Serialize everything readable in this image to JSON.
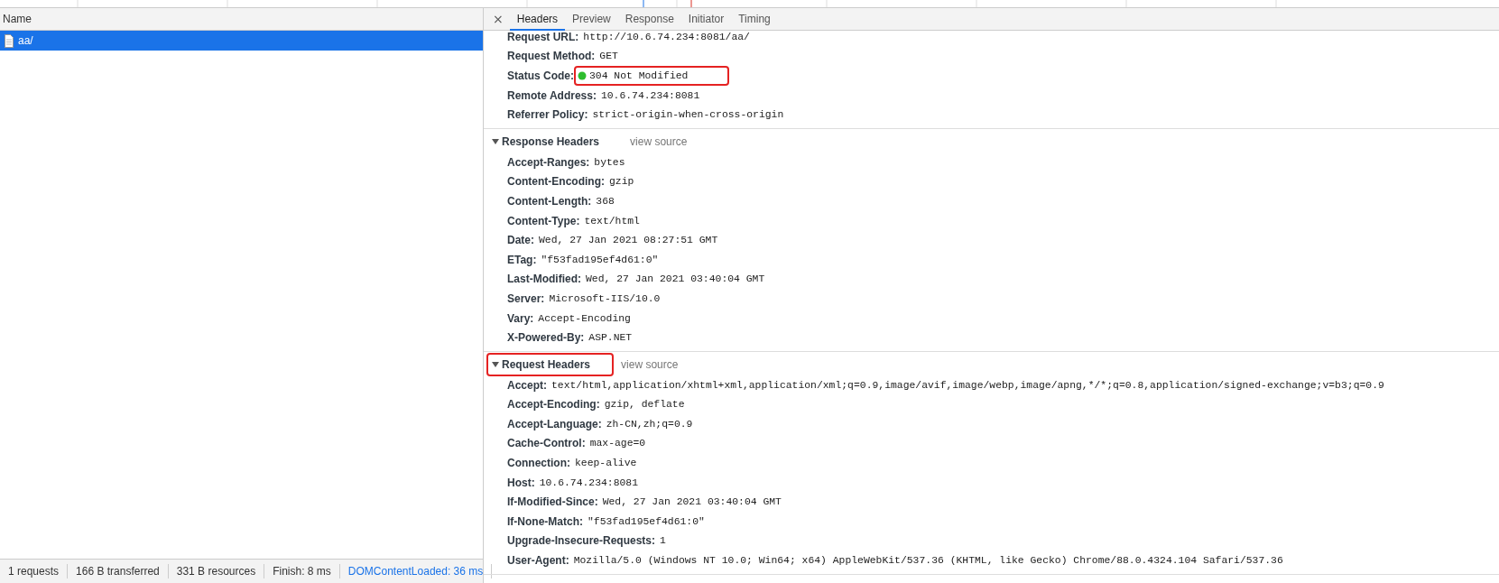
{
  "requests_table": {
    "columns": [
      "Name"
    ],
    "rows": [
      {
        "name": "aa/",
        "selected": true
      }
    ]
  },
  "details": {
    "close": "×",
    "tabs": [
      {
        "label": "Headers",
        "selected": true
      },
      {
        "label": "Preview",
        "selected": false
      },
      {
        "label": "Response",
        "selected": false
      },
      {
        "label": "Initiator",
        "selected": false
      },
      {
        "label": "Timing",
        "selected": false
      }
    ],
    "general": [
      {
        "name": "Request URL:",
        "value": "http://10.6.74.234:8081/aa/",
        "kind": "plain",
        "highlighted": false
      },
      {
        "name": "Request Method:",
        "value": "GET",
        "kind": "plain",
        "highlighted": false
      },
      {
        "name": "Status Code:",
        "value": "304 Not Modified",
        "kind": "status",
        "highlighted": true
      },
      {
        "name": "Remote Address:",
        "value": "10.6.74.234:8081",
        "kind": "plain",
        "highlighted": false
      },
      {
        "name": "Referrer Policy:",
        "value": "strict-origin-when-cross-origin",
        "kind": "plain",
        "highlighted": false
      }
    ],
    "sections": [
      {
        "title": "Response Headers",
        "expanded": true,
        "link": "view source",
        "highlighted": false,
        "headers": [
          {
            "name": "Accept-Ranges:",
            "value": "bytes"
          },
          {
            "name": "Content-Encoding:",
            "value": "gzip"
          },
          {
            "name": "Content-Length:",
            "value": "368"
          },
          {
            "name": "Content-Type:",
            "value": "text/html"
          },
          {
            "name": "Date:",
            "value": "Wed, 27 Jan 2021 08:27:51 GMT"
          },
          {
            "name": "ETag:",
            "value": "\"f53fad195ef4d61:0\""
          },
          {
            "name": "Last-Modified:",
            "value": "Wed, 27 Jan 2021 03:40:04 GMT"
          },
          {
            "name": "Server:",
            "value": "Microsoft-IIS/10.0"
          },
          {
            "name": "Vary:",
            "value": "Accept-Encoding"
          },
          {
            "name": "X-Powered-By:",
            "value": "ASP.NET"
          }
        ]
      },
      {
        "title": "Request Headers",
        "expanded": true,
        "link": "view source",
        "highlighted": true,
        "headers": [
          {
            "name": "Accept:",
            "value": "text/html,application/xhtml+xml,application/xml;q=0.9,image/avif,image/webp,image/apng,*/*;q=0.8,application/signed-exchange;v=b3;q=0.9"
          },
          {
            "name": "Accept-Encoding:",
            "value": "gzip, deflate"
          },
          {
            "name": "Accept-Language:",
            "value": "zh-CN,zh;q=0.9"
          },
          {
            "name": "Cache-Control:",
            "value": "max-age=0"
          },
          {
            "name": "Connection:",
            "value": "keep-alive"
          },
          {
            "name": "Host:",
            "value": "10.6.74.234:8081"
          },
          {
            "name": "If-Modified-Since:",
            "value": "Wed, 27 Jan 2021 03:40:04 GMT"
          },
          {
            "name": "If-None-Match:",
            "value": "\"f53fad195ef4d61:0\""
          },
          {
            "name": "Upgrade-Insecure-Requests:",
            "value": "1"
          },
          {
            "name": "User-Agent:",
            "value": "Mozilla/5.0 (Windows NT 10.0; Win64; x64) AppleWebKit/537.36 (KHTML, like Gecko) Chrome/88.0.4324.104 Safari/537.36"
          }
        ]
      }
    ]
  },
  "status_bar": [
    {
      "text": "1 requests",
      "kind": "plain"
    },
    {
      "text": "166 B transferred",
      "kind": "plain"
    },
    {
      "text": "331 B resources",
      "kind": "plain"
    },
    {
      "text": "Finish: 8 ms",
      "kind": "plain"
    },
    {
      "text": "DOMContentLoaded: 36 ms",
      "kind": "link"
    }
  ]
}
